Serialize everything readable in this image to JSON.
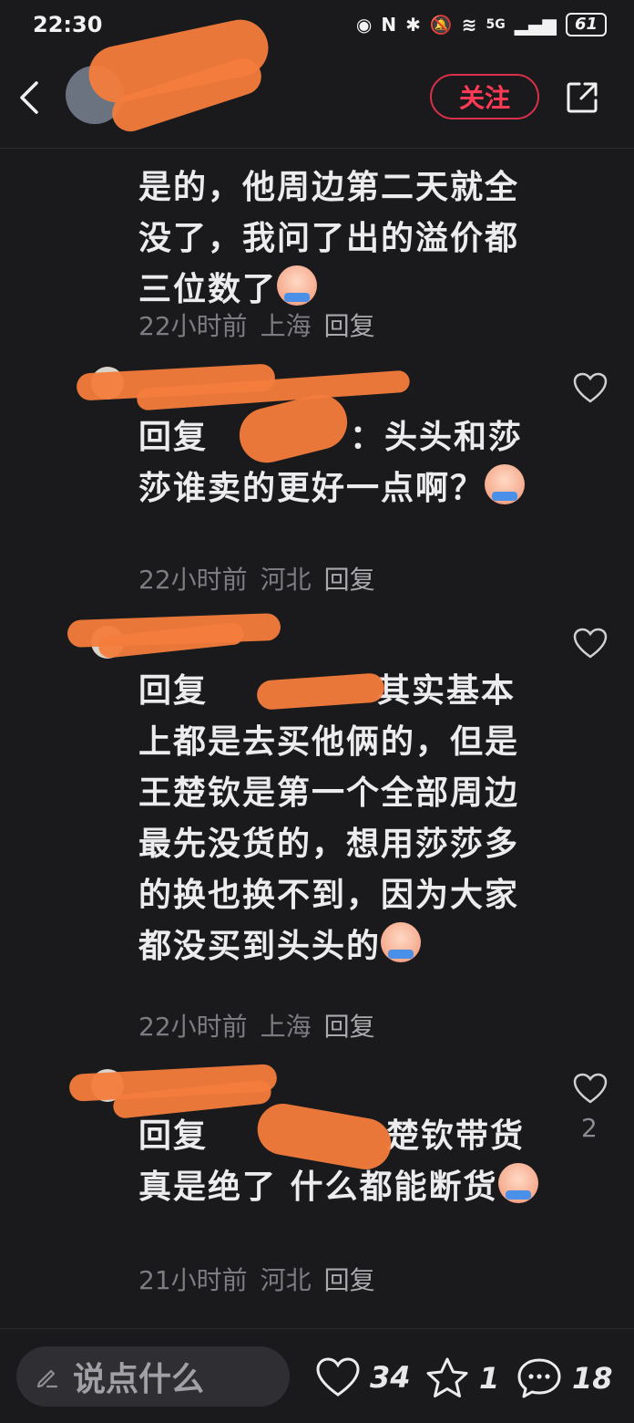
{
  "status": {
    "time": "22:30",
    "network": "5G",
    "battery": "61"
  },
  "header": {
    "follow_label": "关注"
  },
  "comments": [
    {
      "text": "是的，他周边第二天就全没了，我问了出的溢价都三位数了",
      "time": "22小时前",
      "location": "上海",
      "reply": "回复"
    },
    {
      "prefix": "回复",
      "text": "：头头和莎莎谁卖的更好一点啊？",
      "time": "22小时前",
      "location": "河北",
      "reply": "回复"
    },
    {
      "prefix": "回复",
      "text": "其实基本上都是去买他俩的，但是王楚钦是第一个全部周边最先没货的，想用莎莎多的换也换不到，因为大家都没买到头头的",
      "time": "22小时前",
      "location": "上海",
      "reply": "回复"
    },
    {
      "prefix": "回复",
      "text": "楚钦带货真是绝了 什么都能断货",
      "time": "21小时前",
      "location": "河北",
      "reply": "回复",
      "likes": "2"
    }
  ],
  "bottom": {
    "placeholder": "说点什么",
    "likes": "34",
    "favorites": "1",
    "comments": "18"
  }
}
